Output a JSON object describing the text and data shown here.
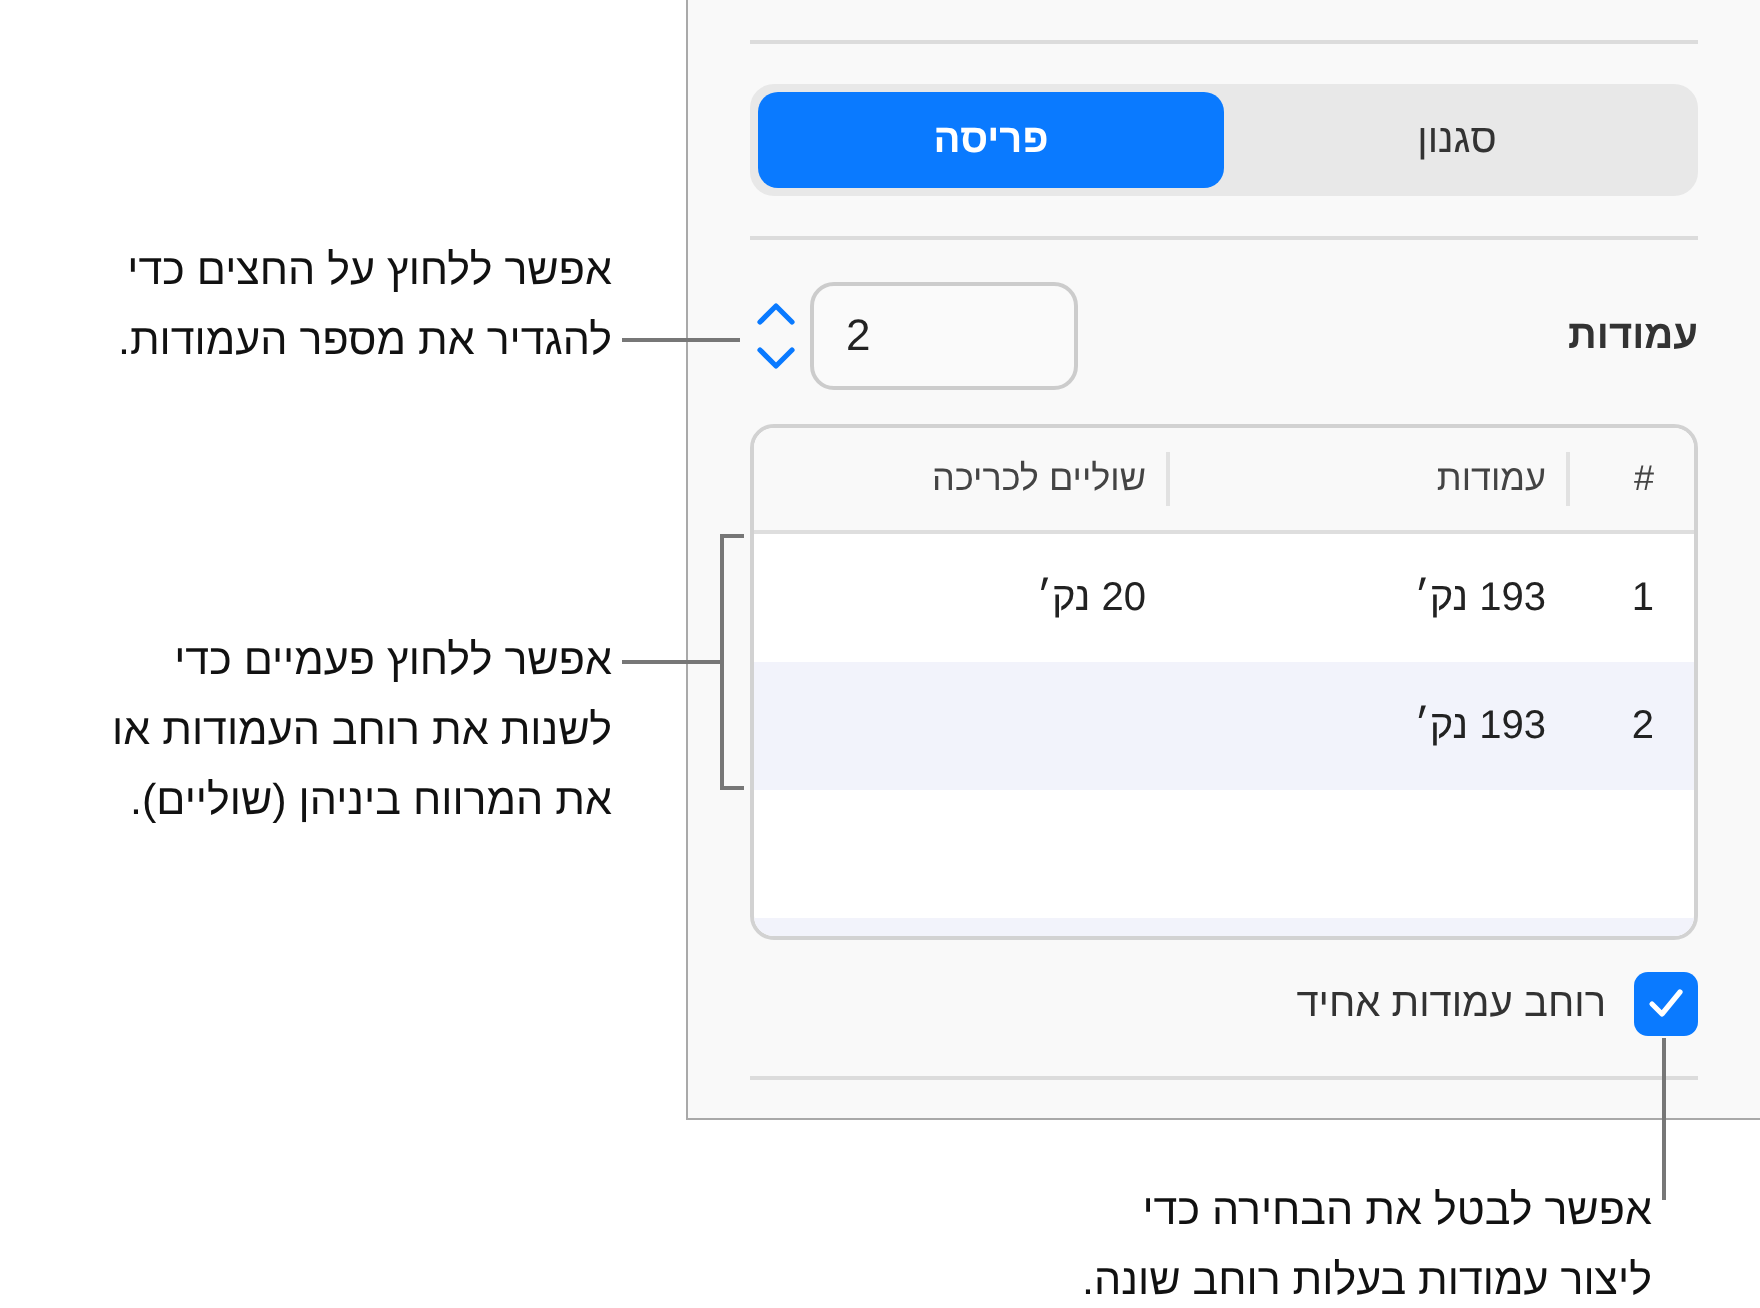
{
  "panel": {
    "tabs": [
      {
        "label": "סגנון",
        "selected": false
      },
      {
        "label": "פריסה",
        "selected": true
      }
    ],
    "columns_label": "עמודות",
    "columns_value": "2",
    "table": {
      "columns": [
        "#",
        "עמודות",
        "שוליים לכריכה"
      ],
      "rows": [
        [
          "1",
          "193 נק׳",
          "20 נק׳"
        ],
        [
          "2",
          "193 נק׳",
          ""
        ]
      ]
    },
    "equal_width": {
      "label": "רוחב עמודות אחיד",
      "checked": true
    }
  },
  "callouts": [
    {
      "lines": [
        "אפשר ללחוץ על החצים כדי",
        "להגדיר את מספר העמודות."
      ]
    },
    {
      "lines": [
        "אפשר ללחוץ פעמיים כדי",
        "לשנות את רוחב העמודות או",
        "את המרווח ביניהן (שוליים)."
      ]
    },
    {
      "lines": [
        "אפשר לבטל את הבחירה כדי",
        "ליצור עמודות בעלות רוחב שונה."
      ]
    }
  ]
}
